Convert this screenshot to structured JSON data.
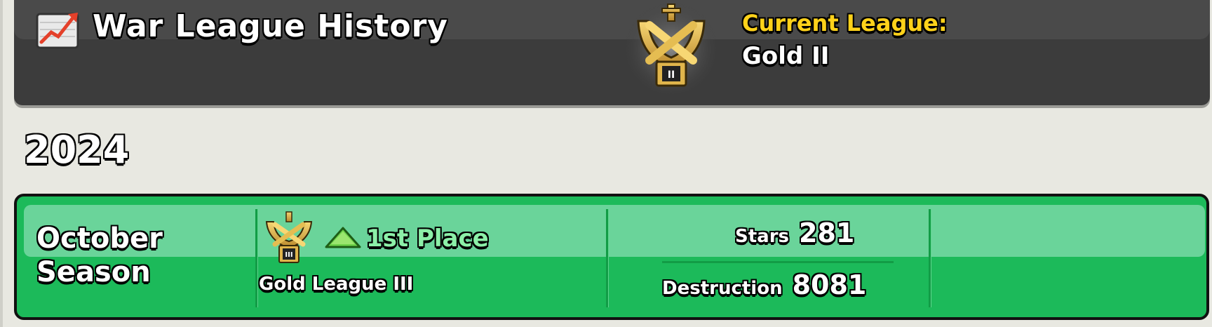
{
  "header": {
    "title": "War League History",
    "current_league_label": "Current League:",
    "current_league_value": "Gold II",
    "badge_numeral": "II"
  },
  "year": "2024",
  "seasons": [
    {
      "name_line1": "October",
      "name_line2": "Season",
      "badge_numeral": "III",
      "placement": "1st Place",
      "league": "Gold League III",
      "stars_label": "Stars",
      "stars_value": "281",
      "destruction_label": "Destruction",
      "destruction_value": "8081"
    }
  ],
  "colors": {
    "header_bg": "#3c3c3c",
    "card_green": "#1cba5a",
    "gold_text": "#ffd21a",
    "placement_green": "#8cf0a8",
    "page_bg": "#e8e8e1"
  },
  "icons": [
    "history-chart-icon",
    "gold-league-badge-icon",
    "promotion-arrow-icon"
  ]
}
